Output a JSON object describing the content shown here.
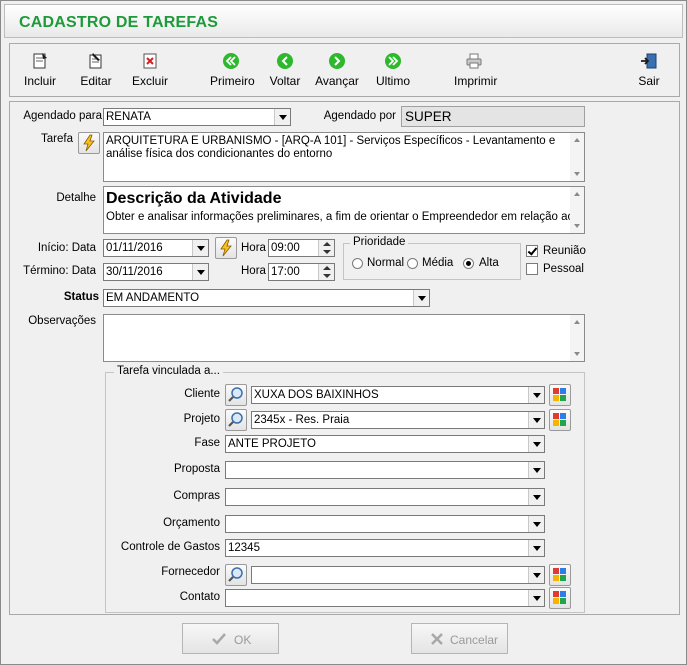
{
  "window": {
    "title": "CADASTRO DE TAREFAS"
  },
  "toolbar": {
    "incluir": "Incluir",
    "editar": "Editar",
    "excluir": "Excluir",
    "primeiro": "Primeiro",
    "voltar": "Voltar",
    "avancar": "Avançar",
    "ultimo": "Ultimo",
    "imprimir": "Imprimir",
    "sair": "Sair"
  },
  "form": {
    "agendado_para_label": "Agendado para",
    "agendado_para_value": "RENATA",
    "agendado_por_label": "Agendado por",
    "agendado_por_value": "SUPER",
    "tarefa_label": "Tarefa",
    "tarefa_text": "ARQUITETURA E URBANISMO - [ARQ-A 101]  - Serviços Específicos - Levantamento e análise física dos condicionantes do entorno",
    "detalhe_label": "Detalhe",
    "detalhe_heading": "Descrição da Atividade",
    "detalhe_text": "Obter e analisar informações preliminares, a fim de orientar o Empreendedor em relação aos",
    "inicio_label": "Início: Data",
    "inicio_data": "01/11/2016",
    "inicio_hora_label": "Hora",
    "inicio_hora": "09:00",
    "termino_label": "Término: Data",
    "termino_data": "30/11/2016",
    "termino_hora_label": "Hora",
    "termino_hora": "17:00",
    "prioridade_label": "Prioridade",
    "prioridade_options": [
      "Normal",
      "Média",
      "Alta"
    ],
    "prioridade_selected": "Alta",
    "reuniao_label": "Reunião",
    "reuniao_checked": true,
    "pessoal_label": "Pessoal",
    "pessoal_checked": false,
    "status_label": "Status",
    "status_value": "EM ANDAMENTO",
    "observacoes_label": "Observações",
    "observacoes_value": ""
  },
  "vinculada": {
    "title": "Tarefa vinculada a...",
    "cliente_label": "Cliente",
    "cliente_value": "XUXA DOS BAIXINHOS",
    "projeto_label": "Projeto",
    "projeto_value": "2345x - Res. Praia",
    "fase_label": "Fase",
    "fase_value": "ANTE PROJETO",
    "proposta_label": "Proposta",
    "proposta_value": "",
    "compras_label": "Compras",
    "compras_value": "",
    "orcamento_label": "Orçamento",
    "orcamento_value": "",
    "controle_label": "Controle de Gastos",
    "controle_value": "12345",
    "fornecedor_label": "Fornecedor",
    "fornecedor_value": "",
    "contato_label": "Contato",
    "contato_value": ""
  },
  "buttons": {
    "ok": "OK",
    "cancelar": "Cancelar"
  },
  "colors": {
    "title": "#1f9a3b",
    "nav_green": "#2db82d"
  }
}
